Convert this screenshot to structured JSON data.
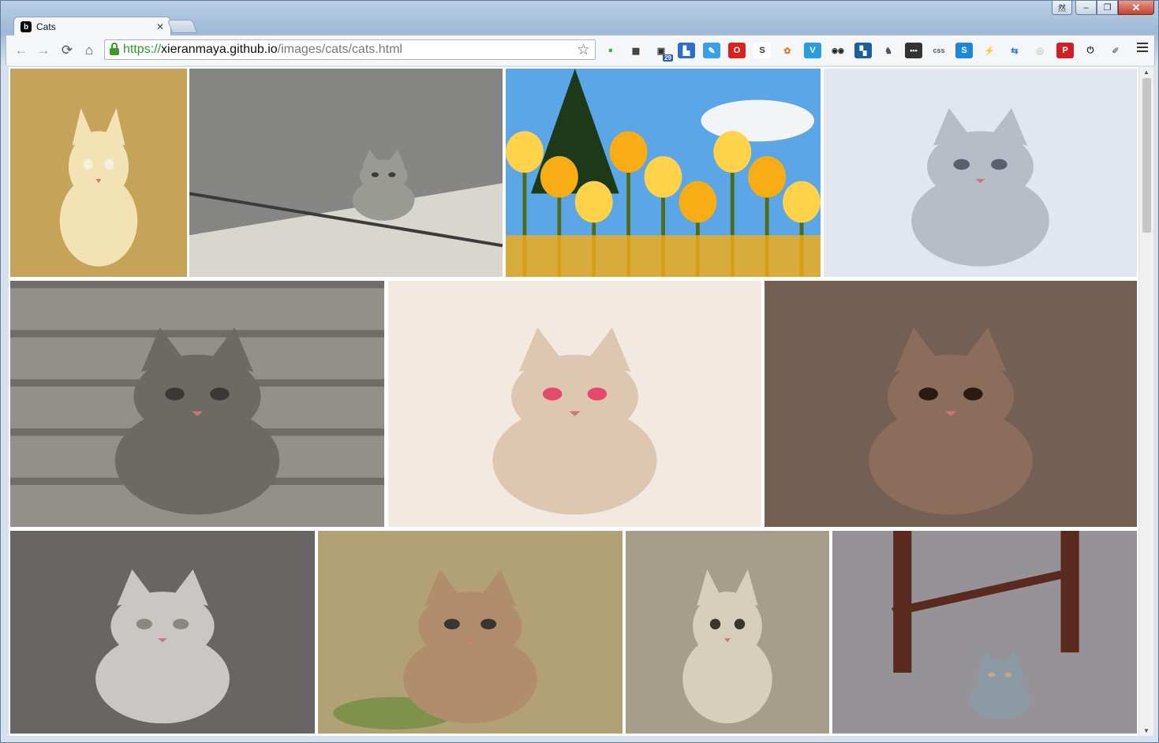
{
  "window": {
    "ime_label": "然",
    "minimize_label": "–",
    "maximize_label": "❐",
    "close_label": "✕"
  },
  "tab": {
    "favicon_letter": "b",
    "title": "Cats",
    "close_label": "✕"
  },
  "toolbar": {
    "back_label": "←",
    "forward_label": "→",
    "reload_label": "⟳",
    "home_label": "⌂",
    "url_scheme": "https://",
    "url_host": "xieranmaya.github.io",
    "url_path": "/images/cats/cats.html",
    "bookmark_label": "☆"
  },
  "extensions": [
    {
      "name": "green-dot-extension-icon",
      "glyph": "●",
      "bg": "transparent",
      "fg": "#3cb043"
    },
    {
      "name": "qr-code-extension-icon",
      "glyph": "▦",
      "bg": "transparent",
      "fg": "#333"
    },
    {
      "name": "qr-count-extension-icon",
      "glyph": "▣",
      "bg": "transparent",
      "fg": "#333",
      "badge": "29"
    },
    {
      "name": "screenshot-extension-icon",
      "glyph": "▙",
      "bg": "#2a6fc9",
      "fg": "#fff"
    },
    {
      "name": "pen-extension-icon",
      "glyph": "✎",
      "bg": "#3aa0e6",
      "fg": "#fff"
    },
    {
      "name": "opera-extension-icon",
      "glyph": "O",
      "bg": "#d8231f",
      "fg": "#fff"
    },
    {
      "name": "s-box-extension-icon",
      "glyph": "S",
      "bg": "#fff",
      "fg": "#333"
    },
    {
      "name": "fruit-extension-icon",
      "glyph": "✿",
      "bg": "transparent",
      "fg": "#e07a1f"
    },
    {
      "name": "v-circle-extension-icon",
      "glyph": "V",
      "bg": "#2d9be0",
      "fg": "#fff"
    },
    {
      "name": "glasses-extension-icon",
      "glyph": "◉◉",
      "bg": "transparent",
      "fg": "#222"
    },
    {
      "name": "window-extension-icon",
      "glyph": "▚",
      "bg": "#1b5e9c",
      "fg": "#fff"
    },
    {
      "name": "evernote-extension-icon",
      "glyph": "♞",
      "bg": "transparent",
      "fg": "#555"
    },
    {
      "name": "dots-extension-icon",
      "glyph": "•••",
      "bg": "#333",
      "fg": "#fff"
    },
    {
      "name": "css-extension-icon",
      "glyph": "css",
      "bg": "transparent",
      "fg": "#555"
    },
    {
      "name": "s-blue-extension-icon",
      "glyph": "S",
      "bg": "#1e88d6",
      "fg": "#fff"
    },
    {
      "name": "lightning-extension-icon",
      "glyph": "⚡",
      "bg": "transparent",
      "fg": "#bbb"
    },
    {
      "name": "translate-extension-icon",
      "glyph": "⇆",
      "bg": "transparent",
      "fg": "#2a7ad5"
    },
    {
      "name": "record-extension-icon",
      "glyph": "◎",
      "bg": "transparent",
      "fg": "#ccc"
    },
    {
      "name": "pinterest-extension-icon",
      "glyph": "P",
      "bg": "#cb2027",
      "fg": "#fff"
    },
    {
      "name": "power-extension-icon",
      "glyph": "⏻",
      "bg": "transparent",
      "fg": "#222"
    },
    {
      "name": "tag-extension-icon",
      "glyph": "✐",
      "bg": "transparent",
      "fg": "#888"
    }
  ],
  "colors": {
    "url_scheme": "#2a9a2a",
    "url_path": "#777777",
    "chrome_frame": "#9fb9d6"
  },
  "gallery": [
    {
      "name": "photo-kitten-clothespin",
      "subject": "kitten hanging on a clothesline with a clothespin",
      "kind": "cat",
      "palette": [
        "#d8b663",
        "#f3e3b4",
        "#8a6a3a",
        "#f6f0e2"
      ]
    },
    {
      "name": "photo-cat-on-boat",
      "subject": "white cat standing on a weathered boat with ropes",
      "kind": "boat",
      "palette": [
        "#6b6b6b",
        "#9a9a95",
        "#d9d6cf",
        "#3b3b3b"
      ]
    },
    {
      "name": "photo-yellow-tulips",
      "subject": "yellow tulips under a blue sky with a pine tree",
      "kind": "tulips",
      "palette": [
        "#5aa6e6",
        "#f7ad13",
        "#ffd24a",
        "#1d3a18"
      ]
    },
    {
      "name": "photo-blue-eyed-kitten",
      "subject": "grey and white blue-eyed kitten on a pale background",
      "kind": "cat",
      "palette": [
        "#dde3ec",
        "#b7bcc6",
        "#f4f5f8",
        "#5a6070"
      ]
    },
    {
      "name": "photo-tabby-kitten-steps",
      "subject": "tabby kitten on concrete steps",
      "kind": "steps",
      "palette": [
        "#8d8a83",
        "#6d6a64",
        "#a9a59c",
        "#3a3936"
      ]
    },
    {
      "name": "photo-kitten-cat-tree",
      "subject": "kitten in a cat tree biting a pink toy",
      "kind": "cat",
      "palette": [
        "#f0e6dd",
        "#ddc7b1",
        "#f8f4f0",
        "#e34a6e"
      ]
    },
    {
      "name": "photo-white-kitten-chair",
      "subject": "white kitten lying on a wooden chair",
      "kind": "cat",
      "palette": [
        "#4a2f22",
        "#8c6c5a",
        "#f2eeec",
        "#2b1a13"
      ]
    },
    {
      "name": "photo-silver-tabby-profile",
      "subject": "silver tabby cat in profile",
      "kind": "cat",
      "palette": [
        "#3e3a3a",
        "#c9c7c5",
        "#e9e8e6",
        "#8b8680"
      ]
    },
    {
      "name": "photo-tabby-walking-dirt",
      "subject": "tabby cat walking on a dirt path",
      "kind": "dirt",
      "palette": [
        "#c9a887",
        "#b08e6c",
        "#6a8c3a",
        "#3a3530"
      ]
    },
    {
      "name": "photo-sepia-kitten-table",
      "subject": "sepia toned kitten resting on a table edge",
      "kind": "sepia",
      "palette": [
        "#b9b19a",
        "#d6cfbb",
        "#6f6856",
        "#3a352a"
      ]
    },
    {
      "name": "photo-calico-kitten-chair",
      "subject": "calico kitten under a wooden chair",
      "kind": "chair",
      "palette": [
        "#a9b6c0",
        "#8c9aa6",
        "#5a2a1e",
        "#c9a487"
      ]
    }
  ]
}
